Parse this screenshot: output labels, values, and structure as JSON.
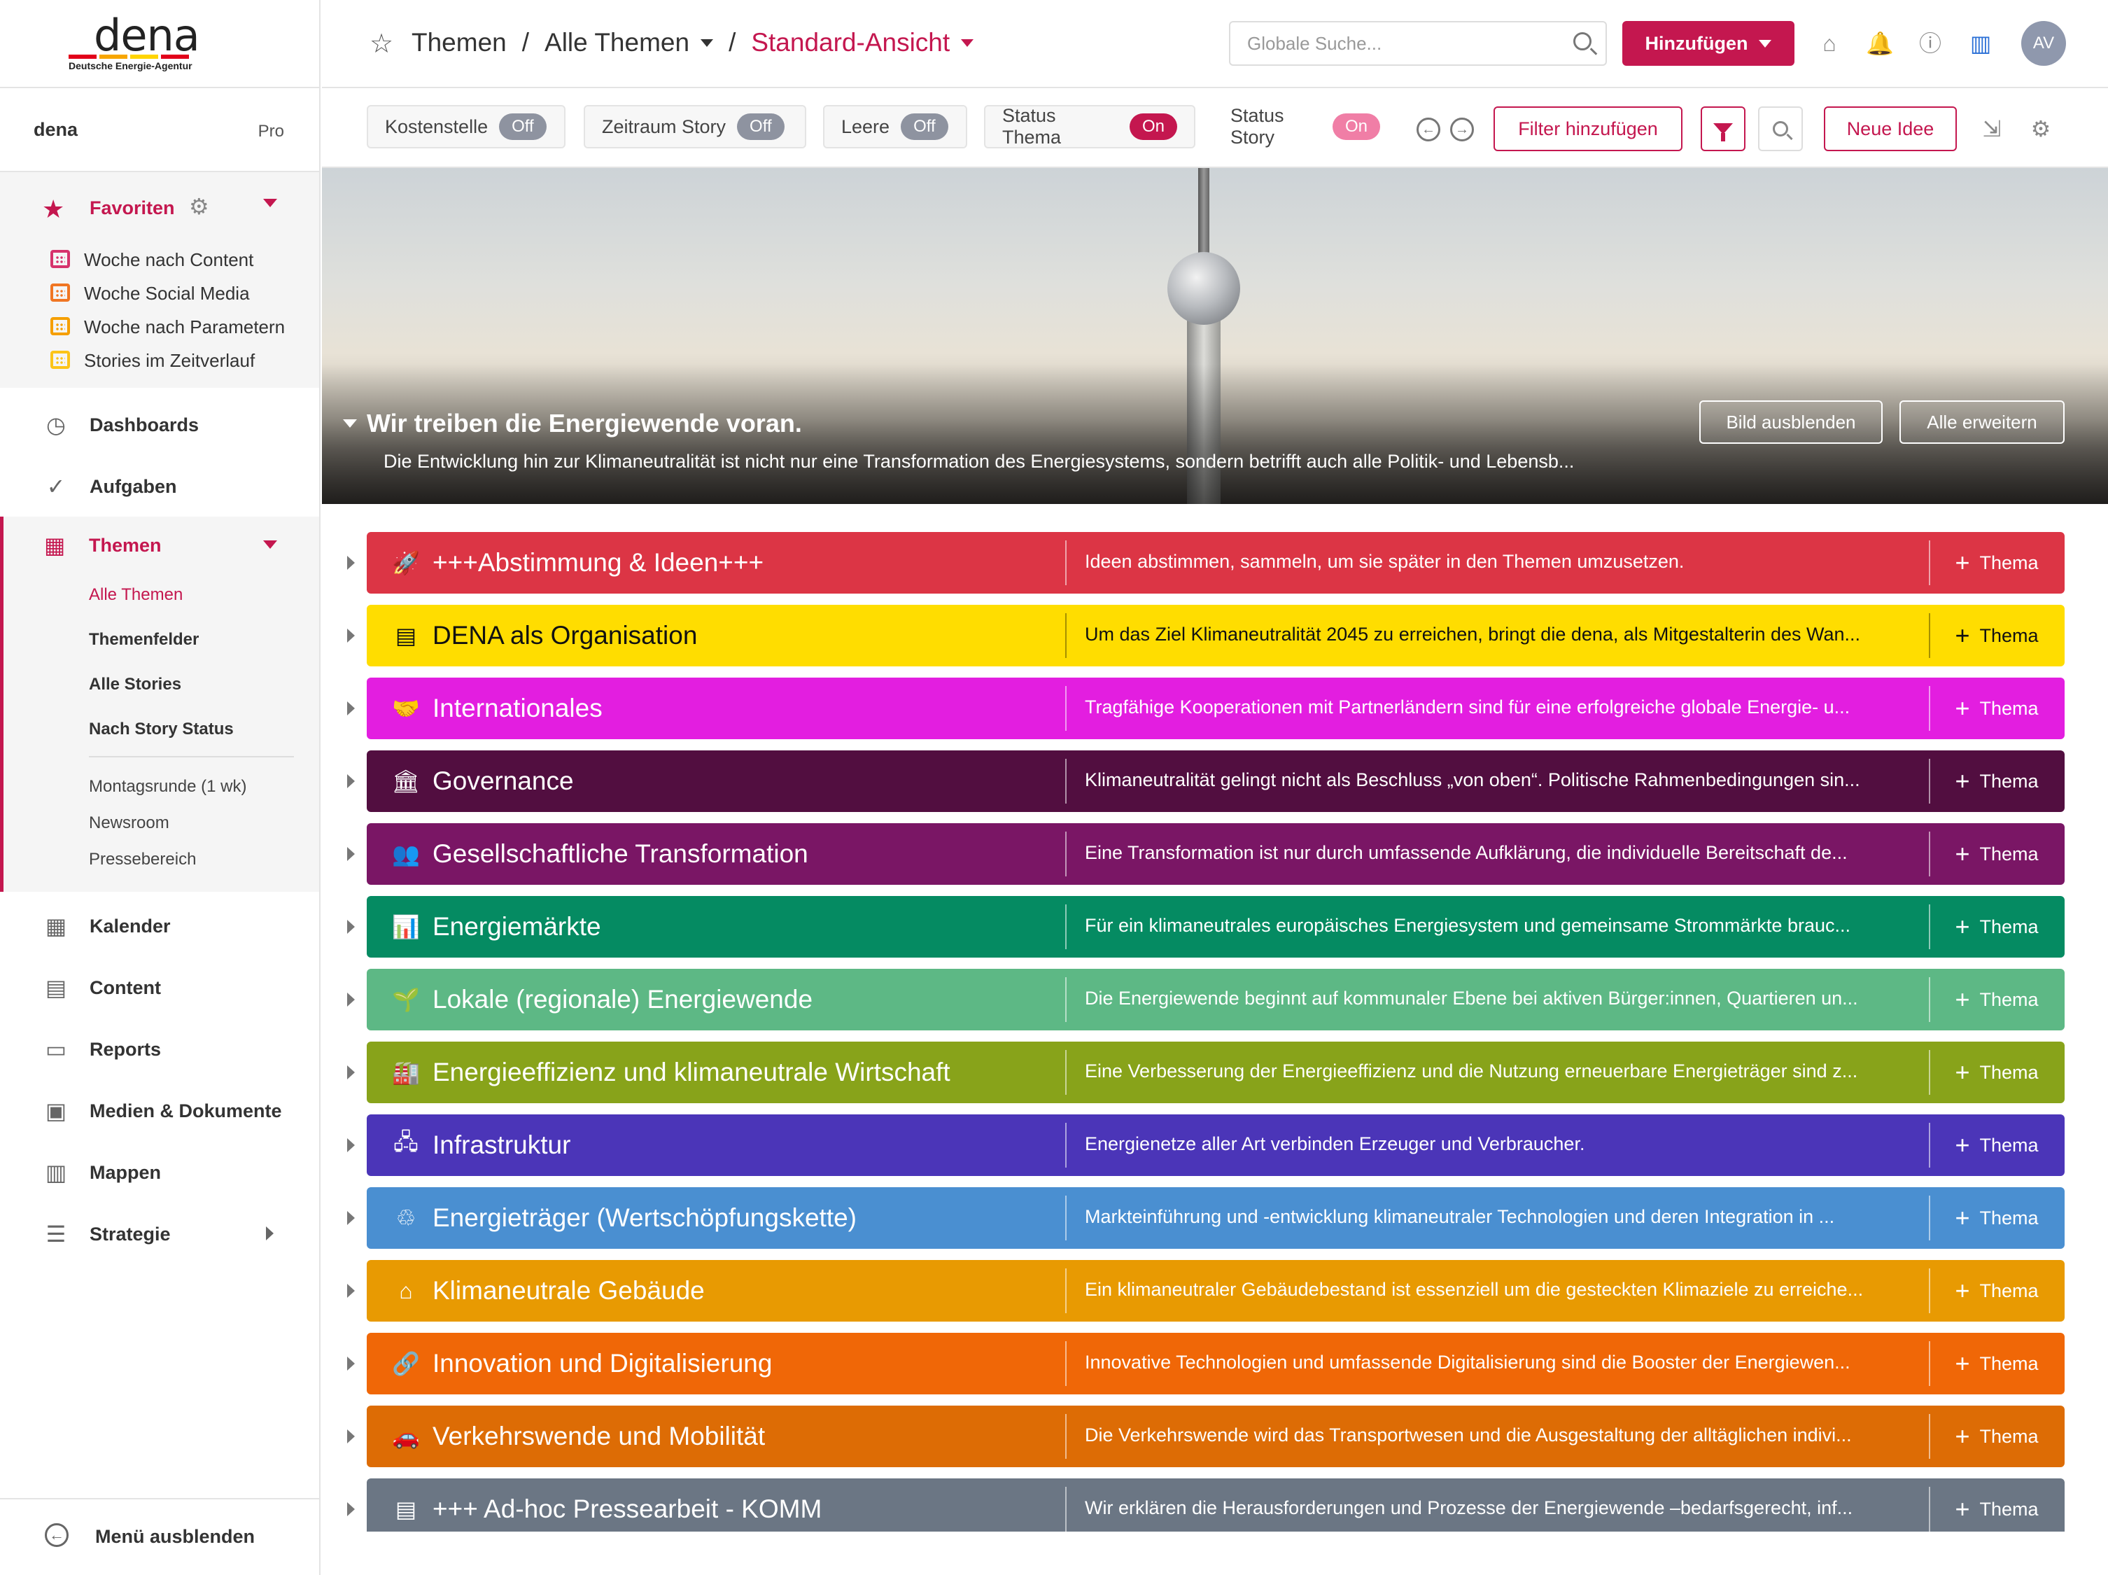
{
  "app": {
    "logo": {
      "word": "dena",
      "subtitle": "Deutsche Energie-Agentur",
      "bar_colors": [
        "#e2001a",
        "#f7a600",
        "#ffd500",
        "#e2001a"
      ]
    },
    "accent_color": "#c4174f"
  },
  "sidebar": {
    "account": {
      "name": "dena",
      "plan": "Pro"
    },
    "favorites": {
      "label": "Favoriten",
      "items": [
        {
          "label": "Woche nach Content",
          "color": "#d6336c"
        },
        {
          "label": "Woche Social Media",
          "color": "#f07623"
        },
        {
          "label": "Woche nach Parametern",
          "color": "#f59f00"
        },
        {
          "label": "Stories im Zeitverlauf",
          "color": "#fcc419"
        }
      ]
    },
    "nav_top": [
      {
        "label": "Dashboards",
        "icon": "compass-icon"
      },
      {
        "label": "Aufgaben",
        "icon": "check-circle-icon"
      }
    ],
    "themen": {
      "label": "Themen",
      "sub_items": [
        {
          "label": "Alle Themen",
          "active": true
        },
        {
          "label": "Themenfelder"
        },
        {
          "label": "Alle Stories"
        },
        {
          "label": "Nach Story Status"
        }
      ],
      "saved_views": [
        {
          "label": "Montagsrunde (1 wk)"
        },
        {
          "label": "Newsroom"
        },
        {
          "label": "Pressebereich"
        }
      ]
    },
    "nav_bottom": [
      {
        "label": "Kalender",
        "icon": "calendar-icon"
      },
      {
        "label": "Content",
        "icon": "content-grid-icon"
      },
      {
        "label": "Reports",
        "icon": "presentation-icon"
      },
      {
        "label": "Medien & Dokumente",
        "icon": "archive-box-icon"
      },
      {
        "label": "Mappen",
        "icon": "briefcase-icon"
      },
      {
        "label": "Strategie",
        "icon": "sliders-icon"
      }
    ],
    "footer": {
      "label": "Menü ausblenden"
    }
  },
  "header": {
    "breadcrumb": {
      "root": "Themen",
      "sep": "/",
      "section": "Alle Themen",
      "view": "Standard-Ansicht"
    },
    "search": {
      "placeholder": "Globale Suche..."
    },
    "add_button": "Hinzufügen",
    "avatar_initials": "AV"
  },
  "filters": {
    "chips": [
      {
        "label": "Kostenstelle",
        "state": "Off"
      },
      {
        "label": "Zeitraum Story",
        "state": "Off"
      },
      {
        "label": "Leere",
        "state": "Off"
      },
      {
        "label": "Status Thema",
        "state": "On"
      },
      {
        "label": "Status Story",
        "state": "On"
      }
    ],
    "add_filter": "Filter hinzufügen",
    "new_idea": "Neue Idee"
  },
  "banner": {
    "title": "Wir treiben die Energiewende voran.",
    "description": "Die Entwicklung hin zur Klimaneutralität ist nicht nur eine Transformation des Energiesystems, sondern betrifft auch alle Politik- und Lebensb...",
    "hide_image": "Bild ausblenden",
    "expand_all": "Alle erweitern"
  },
  "themes": [
    {
      "name": "+++Abstimmung & Ideen+++",
      "desc": "Ideen abstimmen, sammeln, um sie später in den Themen umzusetzen.",
      "color": "#dc3545",
      "text": "#ffffff",
      "icon": "rocket-icon",
      "glyph": "🚀",
      "action": "Thema"
    },
    {
      "name": "DENA als Organisation",
      "desc": "Um das Ziel Klimaneutralität 2045 zu erreichen, bringt die dena, als Mitgestalterin des Wan...",
      "color": "#ffdd00",
      "text": "#111111",
      "icon": "newspaper-icon",
      "glyph": "▤",
      "action": "Thema"
    },
    {
      "name": "Internationales",
      "desc": "Tragfähige Kooperationen mit Partnerländern sind für eine erfolgreiche globale Energie- u...",
      "color": "#e31ee0",
      "text": "#ffffff",
      "icon": "handshake-icon",
      "glyph": "🤝",
      "action": "Thema"
    },
    {
      "name": "Governance",
      "desc": "Klimaneutralität gelingt nicht als Beschluss „von oben“. Politische Rahmenbedingungen sin...",
      "color": "#520e40",
      "text": "#ffffff",
      "icon": "bank-icon",
      "glyph": "🏛",
      "action": "Thema"
    },
    {
      "name": "Gesellschaftliche Transformation",
      "desc": "Eine Transformation ist nur durch umfassende Aufklärung, die individuelle Bereitschaft de...",
      "color": "#7a1665",
      "text": "#ffffff",
      "icon": "people-group-icon",
      "glyph": "👥",
      "action": "Thema"
    },
    {
      "name": "Energiemärkte",
      "desc": "Für ein klimaneutrales europäisches Energiesystem und gemeinsame Strommärkte brauc...",
      "color": "#058b62",
      "text": "#ffffff",
      "icon": "market-chart-icon",
      "glyph": "📊",
      "action": "Thema"
    },
    {
      "name": "Lokale (regionale) Energiewende",
      "desc": "Die Energiewende beginnt auf kommunaler Ebene bei aktiven Bürger:innen, Quartieren un...",
      "color": "#5db885",
      "text": "#ffffff",
      "icon": "plant-hand-icon",
      "glyph": "🌱",
      "action": "Thema"
    },
    {
      "name": "Energieeffizienz und klimaneutrale Wirtschaft",
      "desc": "Eine Verbesserung der Energieeffizienz und die Nutzung erneuerbare Energieträger sind z...",
      "color": "#88a31a",
      "text": "#ffffff",
      "icon": "factory-icon",
      "glyph": "🏭",
      "action": "Thema"
    },
    {
      "name": "Infrastruktur",
      "desc": "Energienetze aller Art verbinden Erzeuger und Verbraucher.",
      "color": "#4b35b8",
      "text": "#ffffff",
      "icon": "network-icon",
      "glyph": "🖧",
      "action": "Thema"
    },
    {
      "name": "Energieträger (Wertschöpfungskette)",
      "desc": "Markteinführung und -entwicklung klimaneutraler Technologien und deren Integration in ...",
      "color": "#4a8fd1",
      "text": "#ffffff",
      "icon": "hands-leaf-icon",
      "glyph": "♲",
      "action": "Thema"
    },
    {
      "name": "Klimaneutrale Gebäude",
      "desc": "Ein klimaneutraler Gebäudebestand ist essenziell um die gesteckten Klimaziele zu erreiche...",
      "color": "#e89a02",
      "text": "#ffffff",
      "icon": "house-icon",
      "glyph": "⌂",
      "action": "Thema"
    },
    {
      "name": "Innovation und Digitalisierung",
      "desc": "Innovative Technologien und umfassende Digitalisierung sind die Booster der Energiewen...",
      "color": "#f06707",
      "text": "#ffffff",
      "icon": "link-icon",
      "glyph": "🔗",
      "action": "Thema"
    },
    {
      "name": "Verkehrswende und Mobilität",
      "desc": "Die Verkehrswende wird das Transportwesen und die Ausgestaltung der alltäglichen indivi...",
      "color": "#dd6c05",
      "text": "#ffffff",
      "icon": "car-person-icon",
      "glyph": "🚗",
      "action": "Thema"
    },
    {
      "name": "+++ Ad-hoc Pressearbeit - KOMM",
      "desc": "Wir erklären die Herausforderungen und Prozesse der Energiewende –bedarfsgerecht, inf...",
      "color": "#6b7684",
      "text": "#ffffff",
      "icon": "newspaper-icon",
      "glyph": "▤",
      "action": "Thema"
    }
  ]
}
